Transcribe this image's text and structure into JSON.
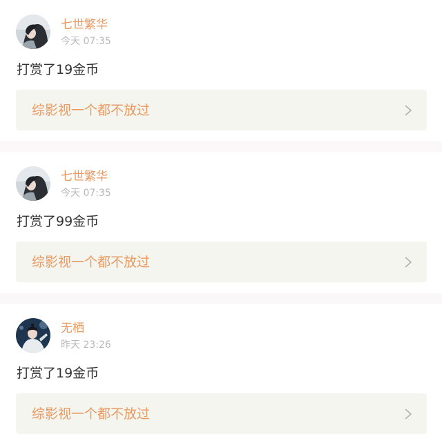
{
  "entries": [
    {
      "username": "七世繁华",
      "timestamp": "今天 07:35",
      "message": "打赏了19金币",
      "book_title": "综影视一个都不放过",
      "avatar_icon": "user-avatar-girl"
    },
    {
      "username": "七世繁华",
      "timestamp": "今天 07:35",
      "message": "打赏了99金币",
      "book_title": "综影视一个都不放过",
      "avatar_icon": "user-avatar-girl"
    },
    {
      "username": "无栖",
      "timestamp": "昨天 23:26",
      "message": "打赏了19金币",
      "book_title": "综影视一个都不放过",
      "avatar_icon": "user-avatar-man"
    }
  ],
  "colors": {
    "username": "#e89a62",
    "book_title": "#e89a62",
    "timestamp": "#b8b8b8",
    "message": "#333333",
    "card_background": "#f5f5ef",
    "divider": "#faf8f8"
  }
}
